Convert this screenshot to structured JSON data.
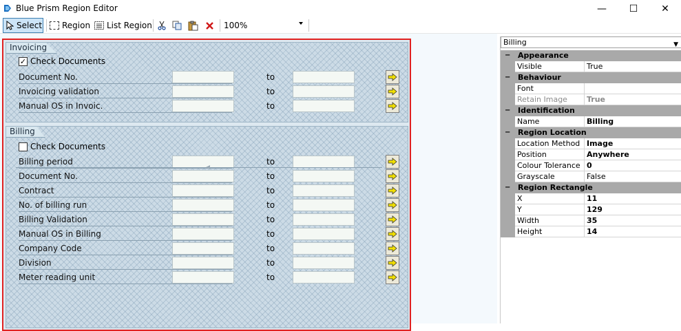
{
  "window": {
    "title": "Blue Prism Region Editor",
    "minimize": "—",
    "maximize": "☐",
    "close": "✕"
  },
  "toolbar": {
    "select_label": "Select",
    "region_label": "Region",
    "list_region_label": "List Region",
    "zoom_value": "100%"
  },
  "invoicing": {
    "title": "Invoicing",
    "check_label": "Check Documents",
    "checked": true,
    "rows": [
      {
        "label": "Document No.",
        "to": "to"
      },
      {
        "label": "Invoicing validation",
        "to": "to"
      },
      {
        "label": "Manual OS in Invoic.",
        "to": "to"
      }
    ]
  },
  "billing": {
    "title": "Billing",
    "check_label": "Check Documents",
    "checked": false,
    "rows": [
      {
        "label": "Billing period",
        "to": "to"
      },
      {
        "label": "Document No.",
        "to": "to"
      },
      {
        "label": "Contract",
        "to": "to"
      },
      {
        "label": "No. of billing run",
        "to": "to"
      },
      {
        "label": "Billing Validation",
        "to": "to"
      },
      {
        "label": "Manual OS in Billing",
        "to": "to"
      },
      {
        "label": "Company Code",
        "to": "to"
      },
      {
        "label": "Division",
        "to": "to"
      },
      {
        "label": "Meter reading unit",
        "to": "to"
      }
    ]
  },
  "properties": {
    "selected_object": "Billing",
    "categories": [
      {
        "name": "Appearance",
        "rows": [
          {
            "name": "Visible",
            "value": "True",
            "bold": false,
            "dim": false
          }
        ]
      },
      {
        "name": "Behaviour",
        "rows": [
          {
            "name": "Font",
            "value": "",
            "bold": false,
            "dim": false
          },
          {
            "name": "Retain Image",
            "value": "True",
            "bold": true,
            "dim": true
          }
        ]
      },
      {
        "name": "Identification",
        "rows": [
          {
            "name": "Name",
            "value": "Billing",
            "bold": true,
            "dim": false
          }
        ]
      },
      {
        "name": "Region Location",
        "rows": [
          {
            "name": "Location Method",
            "value": "Image",
            "bold": true,
            "dim": false
          },
          {
            "name": "Position",
            "value": "Anywhere",
            "bold": true,
            "dim": false
          },
          {
            "name": "Colour Tolerance",
            "value": "0",
            "bold": true,
            "dim": false
          },
          {
            "name": "Grayscale",
            "value": "False",
            "bold": false,
            "dim": false
          }
        ]
      },
      {
        "name": "Region Rectangle",
        "rows": [
          {
            "name": "X",
            "value": "11",
            "bold": true,
            "dim": false
          },
          {
            "name": "Y",
            "value": "129",
            "bold": true,
            "dim": false
          },
          {
            "name": "Width",
            "value": "35",
            "bold": true,
            "dim": false
          },
          {
            "name": "Height",
            "value": "14",
            "bold": true,
            "dim": false
          }
        ]
      }
    ]
  },
  "colors": {
    "region_border": "#e02020",
    "selection_highlight": "#cce4f7",
    "category_bg": "#a9a9a9",
    "select_button_arrow": "#e8d400"
  }
}
